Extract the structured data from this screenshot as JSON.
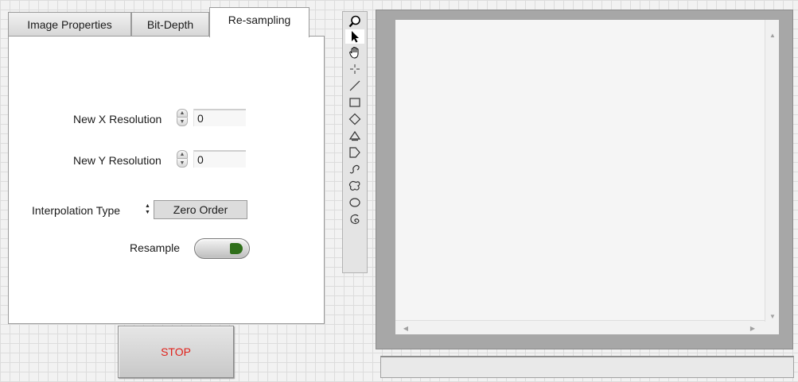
{
  "tabs": [
    {
      "label": "Image Properties",
      "active": false
    },
    {
      "label": "Bit-Depth",
      "active": false
    },
    {
      "label": "Re-sampling",
      "active": true
    }
  ],
  "resampling": {
    "new_x_resolution": {
      "label": "New X Resolution",
      "value": "0"
    },
    "new_y_resolution": {
      "label": "New Y Resolution",
      "value": "0"
    },
    "interpolation_type": {
      "label": "Interpolation Type",
      "selected": "Zero Order"
    },
    "resample": {
      "label": "Resample"
    }
  },
  "stop_button": {
    "label": "STOP",
    "color": "#e0201a"
  },
  "tool_palette": {
    "selected": "pointer-icon",
    "tools": [
      "zoom-icon",
      "pointer-icon",
      "pan-hand-icon",
      "crosshair-point-icon",
      "line-icon",
      "rectangle-icon",
      "rotated-rectangle-icon",
      "annulus-icon",
      "polygon-icon",
      "freehand-line-icon",
      "freehand-region-icon",
      "oval-icon",
      "broken-line-icon"
    ]
  },
  "image_display": {
    "status_text": ""
  },
  "colors": {
    "led_green": "#2f6f1a",
    "frame_gray": "#a7a7a7"
  }
}
